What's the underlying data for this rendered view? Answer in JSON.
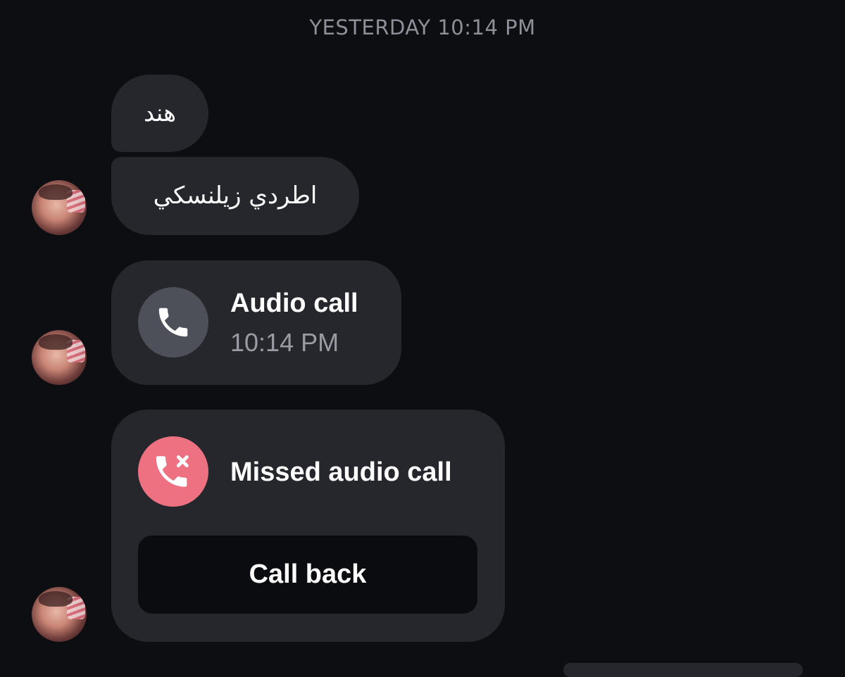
{
  "header": {
    "timestamp": "YESTERDAY 10:14 PM"
  },
  "messages": [
    {
      "type": "text",
      "text": "هند"
    },
    {
      "type": "text",
      "text": "اطردي زيلنسكي"
    }
  ],
  "audio_call": {
    "icon": "phone-icon",
    "title": "Audio call",
    "time": "10:14 PM",
    "icon_bg": "#4d5058"
  },
  "missed_call": {
    "icon": "missed-call-icon",
    "title": "Missed audio call",
    "button_label": "Call back",
    "icon_bg": "#ee7182"
  },
  "colors": {
    "background": "#0d0e12",
    "bubble": "#26272c",
    "secondary_text": "#8d9099"
  }
}
